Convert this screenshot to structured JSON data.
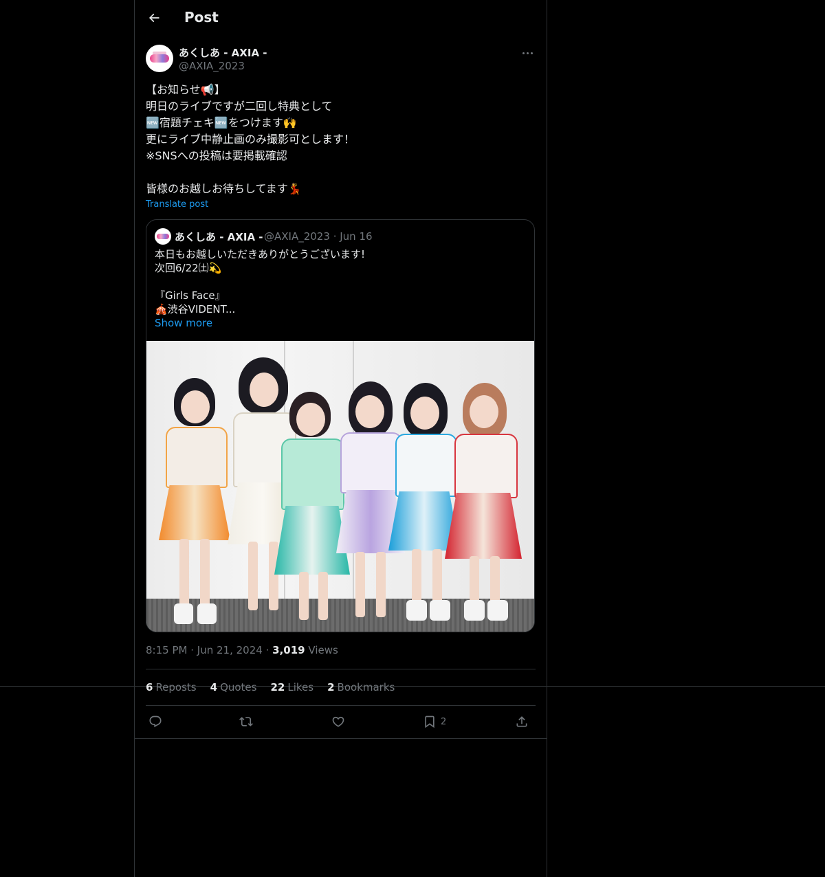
{
  "header": {
    "title": "Post"
  },
  "author": {
    "name": "あくしあ",
    "group": " - AXIA - ",
    "handle": "@AXIA_2023"
  },
  "tweet": {
    "lines": [
      "【お知らせ📢】",
      "明日のライブですが二回し特典として",
      "🆕宿題チェキ🆕をつけます🙌",
      "更にライブ中静止画のみ撮影可とします！",
      "※SNSへの投稿は要掲載確認",
      "",
      "皆様のお越しお待ちしてます💃"
    ],
    "translate_label": "Translate post"
  },
  "quote": {
    "name": "あくしあ",
    "group": " - AXIA - ",
    "handle": "@AXIA_2023",
    "sep": "·",
    "date": "Jun 16",
    "lines": [
      "本日もお越しいただきありがとうございます!",
      "次回6/22㈯💫",
      "",
      "『Girls Face』",
      "🎪渋谷VIDENT..."
    ],
    "show_more": "Show more"
  },
  "meta": {
    "time": "8:15 PM",
    "sep": "·",
    "date": "Jun 21, 2024",
    "views_count": "3,019",
    "views_label": "Views"
  },
  "stats": [
    {
      "count": "6",
      "label": "Reposts"
    },
    {
      "count": "4",
      "label": "Quotes"
    },
    {
      "count": "22",
      "label": "Likes"
    },
    {
      "count": "2",
      "label": "Bookmarks"
    }
  ],
  "actions": {
    "bookmark_count": "2",
    "icons": [
      "reply-icon",
      "repost-icon",
      "like-icon",
      "bookmark-icon",
      "share-icon"
    ]
  },
  "colors": {
    "background": "#000000",
    "text": "#e7e9ea",
    "muted": "#71767b",
    "link": "#1d9bf0",
    "border": "#2f3336"
  }
}
